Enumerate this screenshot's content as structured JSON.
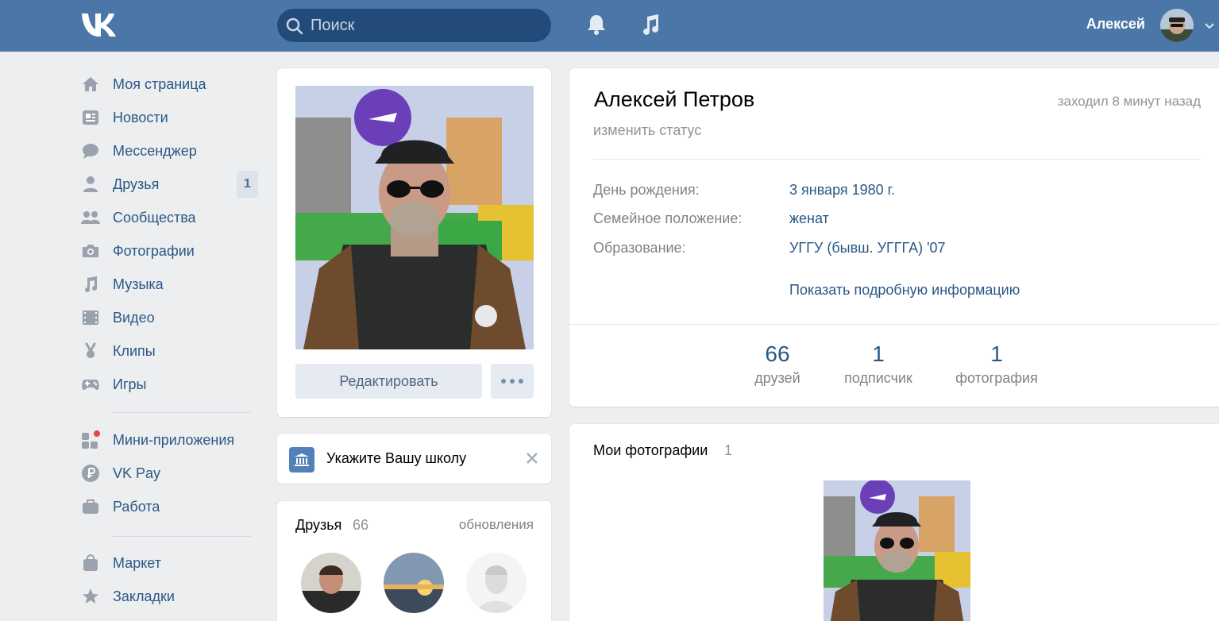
{
  "header": {
    "logo": "vk-logo",
    "search_placeholder": "Поиск",
    "user_name": "Алексей",
    "icons": [
      "bell-icon",
      "music-note-icon"
    ],
    "brand_color": "#4a76a8"
  },
  "left_menu": {
    "items": [
      {
        "label": "Моя страница",
        "icon": "home-icon"
      },
      {
        "label": "Новости",
        "icon": "news-icon"
      },
      {
        "label": "Мессенджер",
        "icon": "messenger-icon"
      },
      {
        "label": "Друзья",
        "icon": "friend-icon",
        "badge": "1"
      },
      {
        "label": "Сообщества",
        "icon": "communities-icon"
      },
      {
        "label": "Фотографии",
        "icon": "camera-icon"
      },
      {
        "label": "Музыка",
        "icon": "music-icon"
      },
      {
        "label": "Видео",
        "icon": "video-icon"
      },
      {
        "label": "Клипы",
        "icon": "clips-icon"
      },
      {
        "label": "Игры",
        "icon": "gamepad-icon"
      },
      {
        "label": "Мини-приложения",
        "icon": "mini-apps-icon"
      },
      {
        "label": "VK Pay",
        "icon": "vkpay-icon"
      },
      {
        "label": "Работа",
        "icon": "briefcase-icon"
      },
      {
        "label": "Маркет",
        "icon": "market-bag-icon"
      },
      {
        "label": "Закладки",
        "icon": "star-icon"
      }
    ]
  },
  "photo_card": {
    "edit_label": "Редактировать"
  },
  "school_card": {
    "text": "Укажите Вашу школу"
  },
  "friends_card": {
    "title": "Друзья",
    "count": "66",
    "updates_label": "обновления"
  },
  "profile": {
    "name": "Алексей Петров",
    "last_seen": "заходил 8 минут назад",
    "change_status": "изменить статус",
    "info": [
      {
        "label": "День рождения:",
        "value": "3 января 1980 г."
      },
      {
        "label": "Семейное положение:",
        "value": "женат"
      },
      {
        "label": "Образование:",
        "value": "УГГУ (бывш. УГГГА) '07"
      }
    ],
    "show_more": "Показать подробную информацию",
    "counters": [
      {
        "value": "66",
        "label": "друзей"
      },
      {
        "value": "1",
        "label": "подписчик"
      },
      {
        "value": "1",
        "label": "фотография"
      }
    ]
  },
  "photos": {
    "title": "Мои фотографии",
    "count": "1"
  }
}
